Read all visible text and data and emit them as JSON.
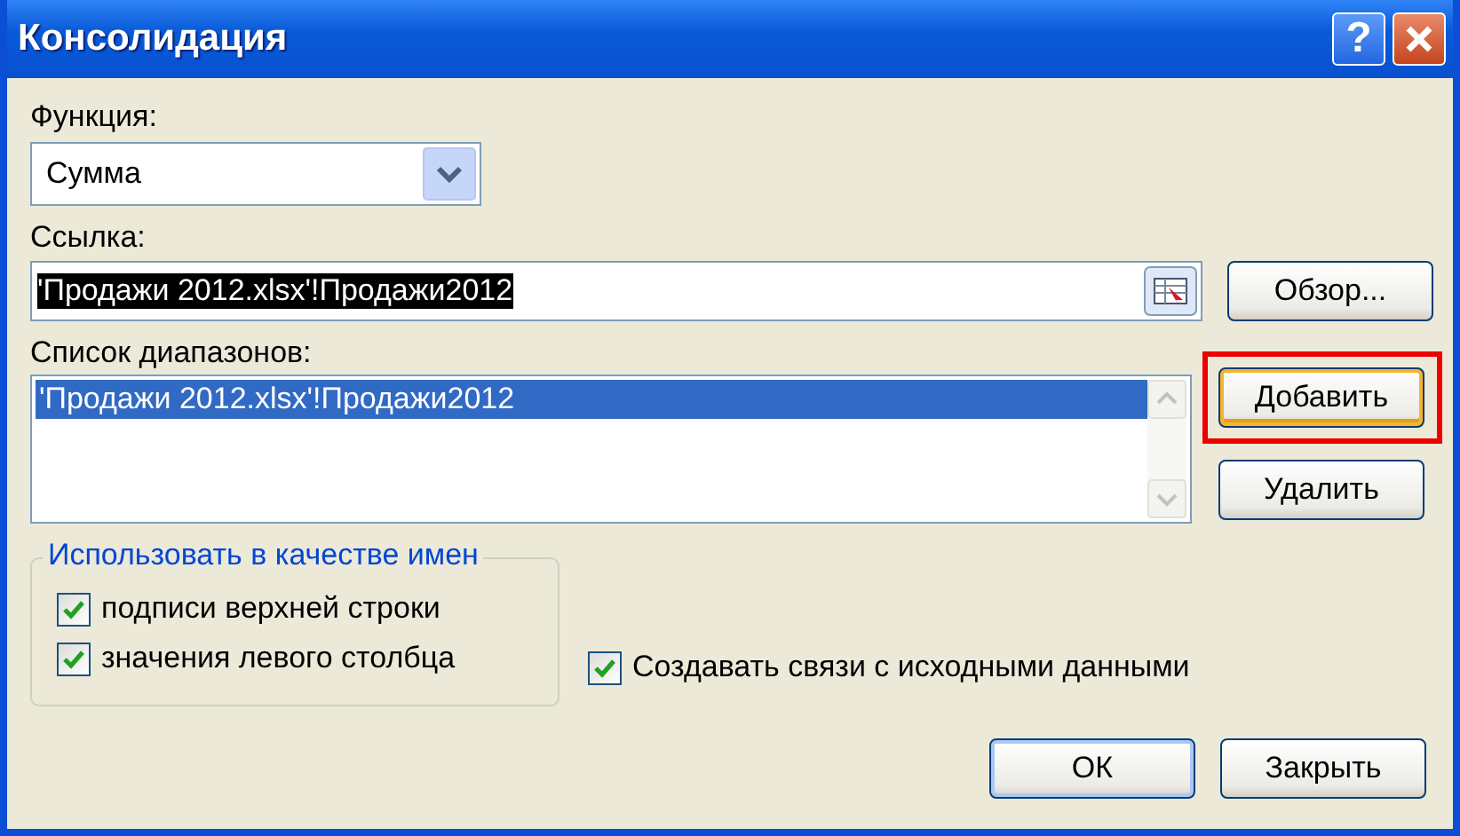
{
  "window": {
    "title": "Консолидация",
    "title_buttons": [
      {
        "kind": "help",
        "label": "?"
      },
      {
        "kind": "close"
      }
    ]
  },
  "function": {
    "label": "Функция:",
    "value": "Сумма"
  },
  "reference": {
    "label": "Ссылка:",
    "value": "'Продажи 2012.xlsx'!Продажи2012",
    "text_selected": true,
    "browse_button": "Обзор..."
  },
  "ranges": {
    "label": "Список диапазонов:",
    "items": [
      {
        "text": "'Продажи 2012.xlsx'!Продажи2012",
        "selected": true
      }
    ]
  },
  "side_buttons": [
    {
      "label": "Добавить",
      "highlighted": true
    },
    {
      "label": "Удалить",
      "highlighted": false
    }
  ],
  "use_labels": {
    "title": "Использовать в качестве имен",
    "options": [
      {
        "label": "подписи верхней строки",
        "checked": true
      },
      {
        "label": "значения левого столбца",
        "checked": true
      }
    ]
  },
  "links_option": {
    "label": "Создавать связи с исходными данными",
    "checked": true
  },
  "buttons": [
    {
      "label": "ОК",
      "default": true
    },
    {
      "label": "Закрыть",
      "default": false
    }
  ]
}
